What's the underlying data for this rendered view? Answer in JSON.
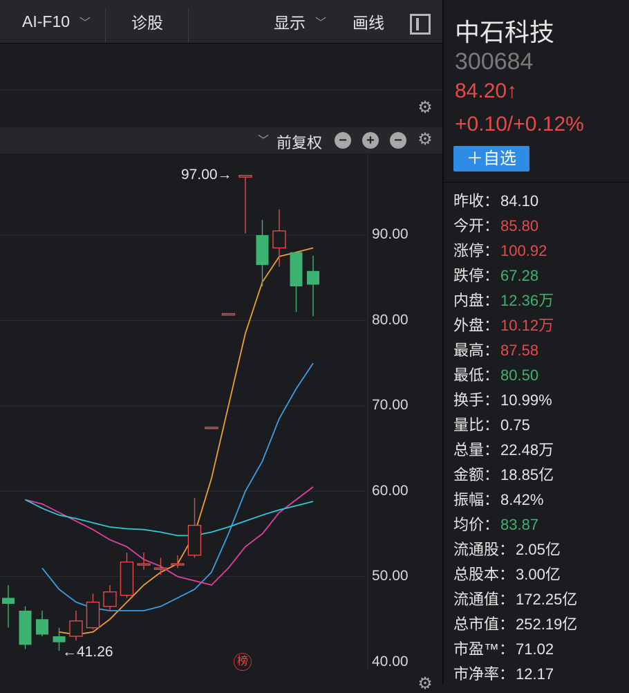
{
  "toolbar": {
    "tab_ai": "AI-F10",
    "tab_diag": "诊股",
    "display": "显示",
    "draw": "画线"
  },
  "chart_header": {
    "adjust": "前复权"
  },
  "stock": {
    "name": "中石科技",
    "code": "300684",
    "price": "84.20↑",
    "change": "+0.10/+0.12%",
    "add_watch": "＋自选"
  },
  "stats": [
    {
      "label": "昨收：",
      "value": "84.10",
      "color": "white"
    },
    {
      "label": "今开：",
      "value": "85.80",
      "color": "red"
    },
    {
      "label": "涨停：",
      "value": "100.92",
      "color": "red"
    },
    {
      "label": "跌停：",
      "value": "67.28",
      "color": "green"
    },
    {
      "label": "内盘：",
      "value": "12.36万",
      "color": "green"
    },
    {
      "label": "外盘：",
      "value": "10.12万",
      "color": "red"
    },
    {
      "label": "最高：",
      "value": "87.58",
      "color": "red"
    },
    {
      "label": "最低：",
      "value": "80.50",
      "color": "green"
    },
    {
      "label": "换手：",
      "value": "10.99%",
      "color": "white"
    },
    {
      "label": "量比：",
      "value": "0.75",
      "color": "white"
    },
    {
      "label": "总量：",
      "value": "22.48万",
      "color": "white"
    },
    {
      "label": "金额：",
      "value": "18.85亿",
      "color": "white"
    },
    {
      "label": "振幅：",
      "value": "8.42%",
      "color": "white"
    },
    {
      "label": "均价：",
      "value": "83.87",
      "color": "green"
    },
    {
      "label": "流通股：",
      "value": "2.05亿",
      "color": "white"
    },
    {
      "label": "总股本：",
      "value": "3.00亿",
      "color": "white"
    },
    {
      "label": "流通值：",
      "value": "172.25亿",
      "color": "white"
    },
    {
      "label": "总市值：",
      "value": "252.19亿",
      "color": "white"
    },
    {
      "label": "市盈™：",
      "value": "71.02",
      "color": "white"
    },
    {
      "label": "市净率：",
      "value": "12.17",
      "color": "white"
    }
  ],
  "colors": {
    "up": "#e84a4a",
    "down": "#3cb371",
    "ma5": "#f0a030",
    "ma10": "#3a9ee8",
    "ma20": "#e040a0",
    "ma30": "#30c8d8"
  },
  "chart_data": {
    "type": "candlestick",
    "y_ticks": [
      "90.00",
      "80.00",
      "70.00",
      "60.00",
      "50.00",
      "40.00"
    ],
    "ylim": [
      40,
      97.5
    ],
    "high_label": "97.00→",
    "low_label": "←41.26",
    "badge": "榜",
    "candles": [
      {
        "o": 47.5,
        "h": 49.0,
        "l": 44.0,
        "c": 46.8
      },
      {
        "o": 46.0,
        "h": 46.5,
        "l": 41.5,
        "c": 42.0
      },
      {
        "o": 45.0,
        "h": 46.0,
        "l": 43.0,
        "c": 43.2
      },
      {
        "o": 43.0,
        "h": 44.0,
        "l": 41.3,
        "c": 42.3
      },
      {
        "o": 43.0,
        "h": 46.0,
        "l": 42.5,
        "c": 44.8
      },
      {
        "o": 44.0,
        "h": 48.0,
        "l": 43.8,
        "c": 47.0
      },
      {
        "o": 46.5,
        "h": 49.0,
        "l": 46.0,
        "c": 48.2
      },
      {
        "o": 47.8,
        "h": 52.8,
        "l": 47.5,
        "c": 51.7
      },
      {
        "o": 51.5,
        "h": 52.8,
        "l": 50.8,
        "c": 51.5
      },
      {
        "o": 51.0,
        "h": 52.2,
        "l": 50.2,
        "c": 51.0
      },
      {
        "o": 51.5,
        "h": 52.5,
        "l": 51.0,
        "c": 51.5
      },
      {
        "o": 52.5,
        "h": 59.2,
        "l": 52.2,
        "c": 56.0
      },
      {
        "o": 67.5,
        "h": 67.5,
        "l": 67.5,
        "c": 67.5
      },
      {
        "o": 80.8,
        "h": 80.8,
        "l": 80.8,
        "c": 80.8
      },
      {
        "o": 96.8,
        "h": 97.0,
        "l": 90.2,
        "c": 97.0
      },
      {
        "o": 90.0,
        "h": 91.8,
        "l": 84.0,
        "c": 86.5
      },
      {
        "o": 88.5,
        "h": 93.0,
        "l": 86.3,
        "c": 90.5
      },
      {
        "o": 88.0,
        "h": 88.0,
        "l": 81.0,
        "c": 84.0
      },
      {
        "o": 85.8,
        "h": 87.6,
        "l": 80.5,
        "c": 84.2
      }
    ],
    "series": [
      {
        "values": [
          null,
          null,
          null,
          43.5,
          43.2,
          43.5,
          45.0,
          47.0,
          49.0,
          50.5,
          51.5,
          55.0,
          61.5,
          70.0,
          78.5,
          84.5,
          87.5,
          88.0,
          88.5
        ]
      },
      {
        "values": [
          51.0,
          48.5,
          47.0,
          46.3,
          46.0,
          46.0,
          46.0,
          46.5,
          47.5,
          48.5,
          50.5,
          55.0,
          60.0,
          63.5,
          68.5,
          72.0,
          75.0
        ]
      },
      {
        "values": [
          59.0,
          58.5,
          57.5,
          56.5,
          55.5,
          54.3,
          53.5,
          52.0,
          51.2,
          50.0,
          49.5,
          49.0,
          51.0,
          53.5,
          55.0,
          57.5,
          59.0,
          60.5
        ]
      },
      {
        "values": [
          59.0,
          58.0,
          57.2,
          56.8,
          56.3,
          55.8,
          55.6,
          55.5,
          55.2,
          54.8,
          54.8,
          55.2,
          55.8,
          56.5,
          57.2,
          57.8,
          58.3,
          58.8
        ]
      }
    ]
  }
}
